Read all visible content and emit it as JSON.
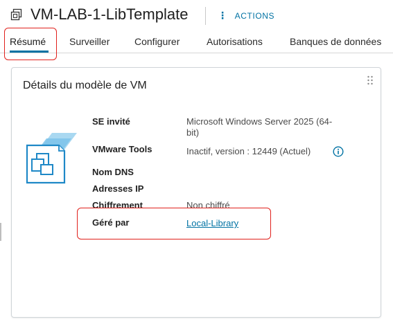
{
  "header": {
    "title": "VM-LAB-1-LibTemplate",
    "actions_label": "ACTIONS"
  },
  "tabs": [
    {
      "label": "Résumé",
      "active": true
    },
    {
      "label": "Surveiller"
    },
    {
      "label": "Configurer"
    },
    {
      "label": "Autorisations"
    },
    {
      "label": "Banques de données"
    }
  ],
  "card": {
    "title": "Détails du modèle de VM",
    "rows": [
      {
        "label": "SE invité",
        "value_line1": "Microsoft Windows Server 2025 (64-",
        "value_line2": "bit)"
      },
      {
        "label": "VMware Tools",
        "value": "Inactif, version : 12449 (Actuel)"
      },
      {
        "label": "Nom DNS",
        "value": ""
      },
      {
        "label": "Adresses IP",
        "value": ""
      },
      {
        "label": "Chiffrement",
        "value": "Non chiffré"
      },
      {
        "label": "Géré par",
        "value": "Local-Library"
      }
    ]
  },
  "icons": {
    "title": "vm-template-icon",
    "actions": "vertical-dots-icon",
    "info": "info-icon",
    "grip": "drag-grip-icon",
    "vm": "vm-template-large-icon"
  },
  "colors": {
    "accent": "#0072a3",
    "annotation": "#e0201b"
  }
}
